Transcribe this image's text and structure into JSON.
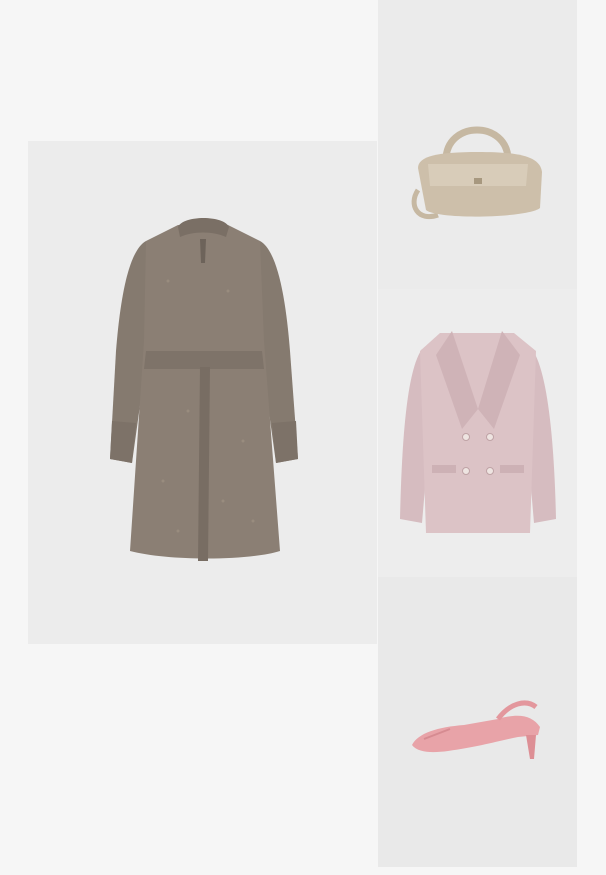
{
  "outfit": {
    "items": [
      {
        "product": "dress",
        "color": "#8a7d72"
      },
      {
        "product": "handbag",
        "color": "#cdbfaa"
      },
      {
        "product": "blazer",
        "color": "#dcc3c6"
      },
      {
        "product": "slingback-heel",
        "color": "#e8a3a8"
      }
    ],
    "background": "#f6f6f6"
  }
}
